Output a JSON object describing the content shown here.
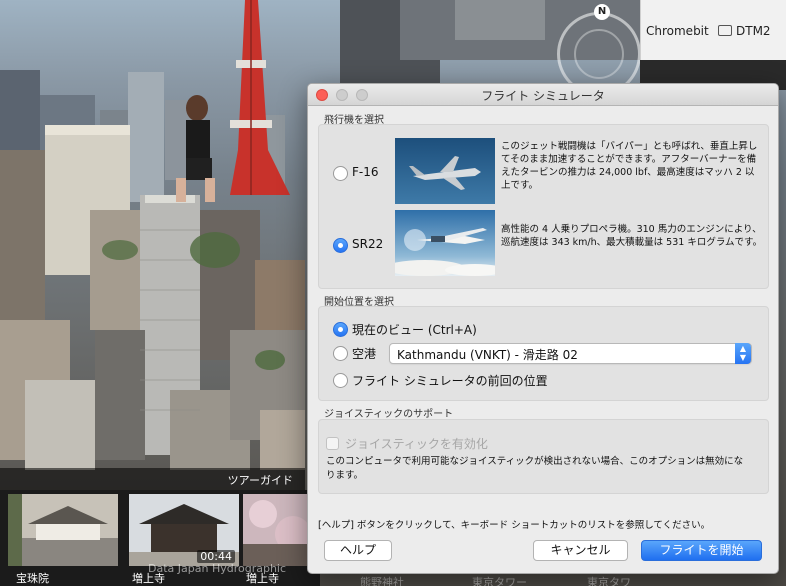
{
  "bookmarks": {
    "items": [
      {
        "label": "Chromebit",
        "icon": "none"
      },
      {
        "label": "DTM2",
        "icon": "folder-icon"
      }
    ]
  },
  "compass": {
    "north_label": "N"
  },
  "tour": {
    "label": "ツアーガイド",
    "thumbnails": [
      {
        "caption": "宝珠院",
        "duration": ""
      },
      {
        "caption": "増上寺",
        "duration": "00:44"
      },
      {
        "caption": "増上寺",
        "duration": ""
      }
    ],
    "attribution": "Data Japan Hydrographic",
    "faded_captions": [
      "熊野神社",
      "東京タワー",
      "東京タワ"
    ]
  },
  "dialog": {
    "title": "フライト シミュレータ",
    "aircraft_section": "飛行機を選択",
    "aircraft": [
      {
        "name": "F-16",
        "selected": false,
        "description": "このジェット戦闘機は「バイパー」とも呼ばれ、垂直上昇してそのまま加速することができます。アフターバーナーを備えたタービンの推力は 24,000 lbf、最高速度はマッハ 2 以上です。"
      },
      {
        "name": "SR22",
        "selected": true,
        "description": "高性能の 4 人乗りプロペラ機。310 馬力のエンジンにより、巡航速度は 343 km/h、最大積載量は 531 キログラムです。"
      }
    ],
    "start_section": "開始位置を選択",
    "start_options": {
      "current_view": {
        "label": "現在のビュー (Ctrl+A)",
        "selected": true
      },
      "airport": {
        "label": "空港",
        "selected": false,
        "value": "Kathmandu (VNKT) - 滑走路 02"
      },
      "previous": {
        "label": "フライト シミュレータの前回の位置",
        "selected": false
      }
    },
    "joystick_section": "ジョイスティックのサポート",
    "joystick": {
      "enable_label": "ジョイスティックを有効化",
      "enabled": false,
      "note": "このコンピュータで利用可能なジョイスティックが検出されない場合、このオプションは無効になります。"
    },
    "footer_text": "[ヘルプ] ボタンをクリックして、キーボード ショートカットのリストを参照してください。",
    "buttons": {
      "help": "ヘルプ",
      "cancel": "キャンセル",
      "start": "フライトを開始"
    }
  },
  "colors": {
    "accent": "#2674f3",
    "close": "#fc5f57",
    "dialog_bg": "#ececec"
  }
}
